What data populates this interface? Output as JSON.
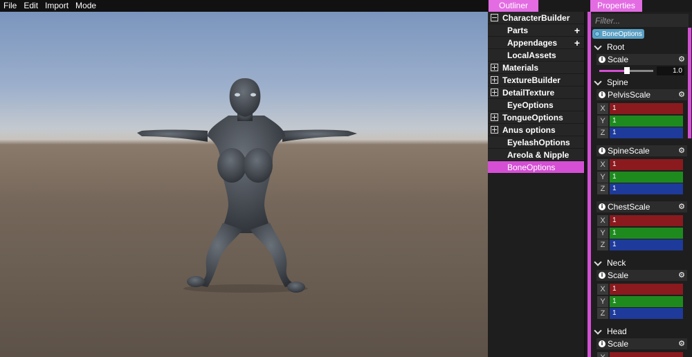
{
  "menu": [
    "File",
    "Edit",
    "Import",
    "Mode"
  ],
  "outliner": {
    "tab_label": "Outliner",
    "items": [
      {
        "label": "CharacterBuilder",
        "toggle": "minus"
      },
      {
        "label": "Parts",
        "toggle": "none",
        "add": "+"
      },
      {
        "label": "Appendages",
        "toggle": "none",
        "add": "+"
      },
      {
        "label": "LocalAssets",
        "toggle": "none"
      },
      {
        "label": "Materials",
        "toggle": "plus"
      },
      {
        "label": "TextureBuilder",
        "toggle": "plus"
      },
      {
        "label": "DetailTexture",
        "toggle": "plus"
      },
      {
        "label": "EyeOptions",
        "toggle": "none"
      },
      {
        "label": "TongueOptions",
        "toggle": "plus"
      },
      {
        "label": "Anus options",
        "toggle": "plus"
      },
      {
        "label": "EyelashOptions",
        "toggle": "none"
      },
      {
        "label": "Areola & Nipple",
        "toggle": "none"
      },
      {
        "label": "BoneOptions",
        "toggle": "none",
        "selected": true
      }
    ]
  },
  "properties": {
    "tab_label": "Properties",
    "filter_placeholder": "Filter...",
    "chip_label": "BoneOptions",
    "sections": {
      "root": {
        "title": "Root",
        "scale_label": "Scale",
        "slider_value": "1.0",
        "slider_fraction": 0.5
      },
      "spine": {
        "title": "Spine",
        "pelvis": {
          "title": "PelvisScale",
          "x": "1",
          "y": "1",
          "z": "1"
        },
        "spinescale": {
          "title": "SpineScale",
          "x": "1",
          "y": "1",
          "z": "1"
        },
        "chest": {
          "title": "ChestScale",
          "x": "1",
          "y": "1",
          "z": "1"
        }
      },
      "neck": {
        "title": "Neck",
        "scale": {
          "title": "Scale",
          "x": "1",
          "y": "1",
          "z": "1"
        }
      },
      "head": {
        "title": "Head",
        "scale": {
          "title": "Scale"
        }
      }
    },
    "axis_labels": {
      "x": "X",
      "y": "Y",
      "z": "Z"
    },
    "info_glyph": "i",
    "gear_glyph": "⚙"
  },
  "colors": {
    "accent": "#d44fd4",
    "x_field": "#8a1a1e",
    "y_field": "#1e8a1e",
    "z_field": "#1e3a9a"
  }
}
